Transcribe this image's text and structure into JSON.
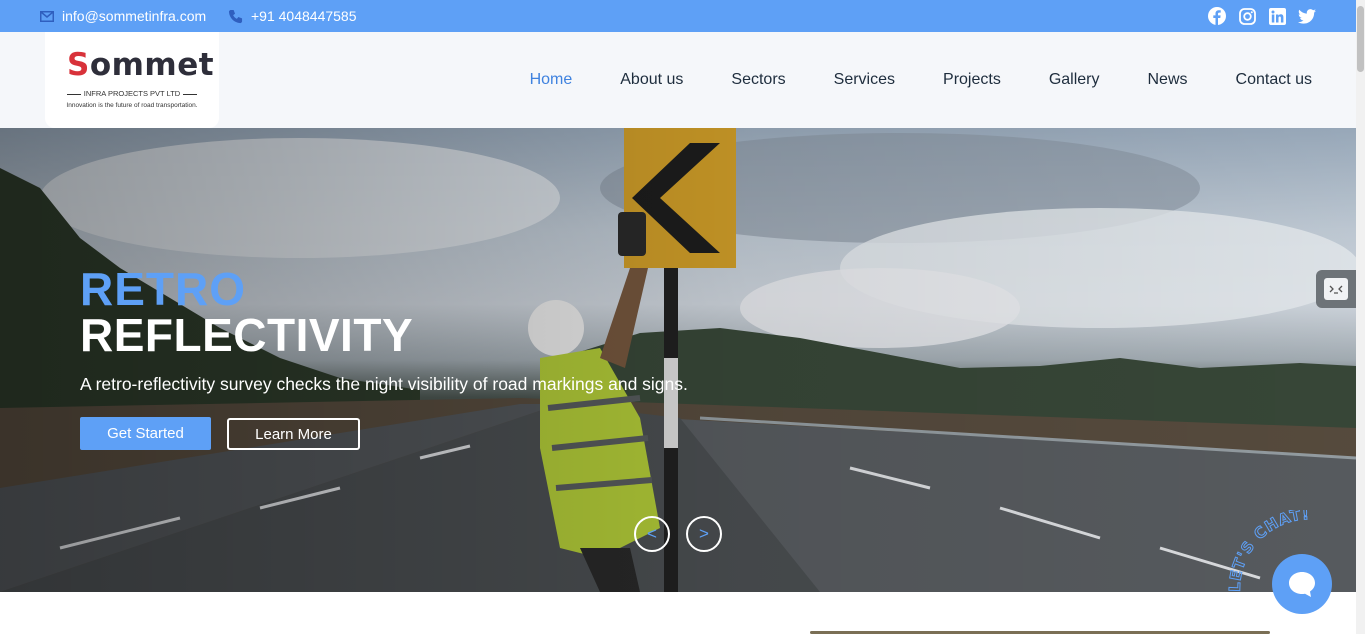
{
  "topbar": {
    "email": "info@sommetinfra.com",
    "phone": "+91 4048447585",
    "social_icons": [
      "facebook-icon",
      "instagram-icon",
      "linkedin-icon",
      "twitter-icon"
    ]
  },
  "logo": {
    "brand_initial": "S",
    "brand_rest": "ommet",
    "subtitle": "INFRA PROJECTS PVT LTD",
    "tagline": "Innovation is the future of road transportation."
  },
  "nav": {
    "items": [
      "Home",
      "About us",
      "Sectors",
      "Services",
      "Projects",
      "Gallery",
      "News",
      "Contact us"
    ],
    "active": "Home"
  },
  "hero": {
    "title_highlight": "RETRO",
    "title_main": "REFLECTIVITY",
    "description": "A retro-reflectivity survey checks the night visibility of road markings and signs.",
    "primary_button": "Get Started",
    "secondary_button": "Learn More",
    "prev_label": "<",
    "next_label": ">"
  },
  "chat": {
    "label": "LET'S CHAT!"
  },
  "colors": {
    "accent": "#5ea0f6",
    "nav_active": "#3f82df",
    "nav_text": "#1e2d3d",
    "header_bg": "#f5f7fa"
  }
}
